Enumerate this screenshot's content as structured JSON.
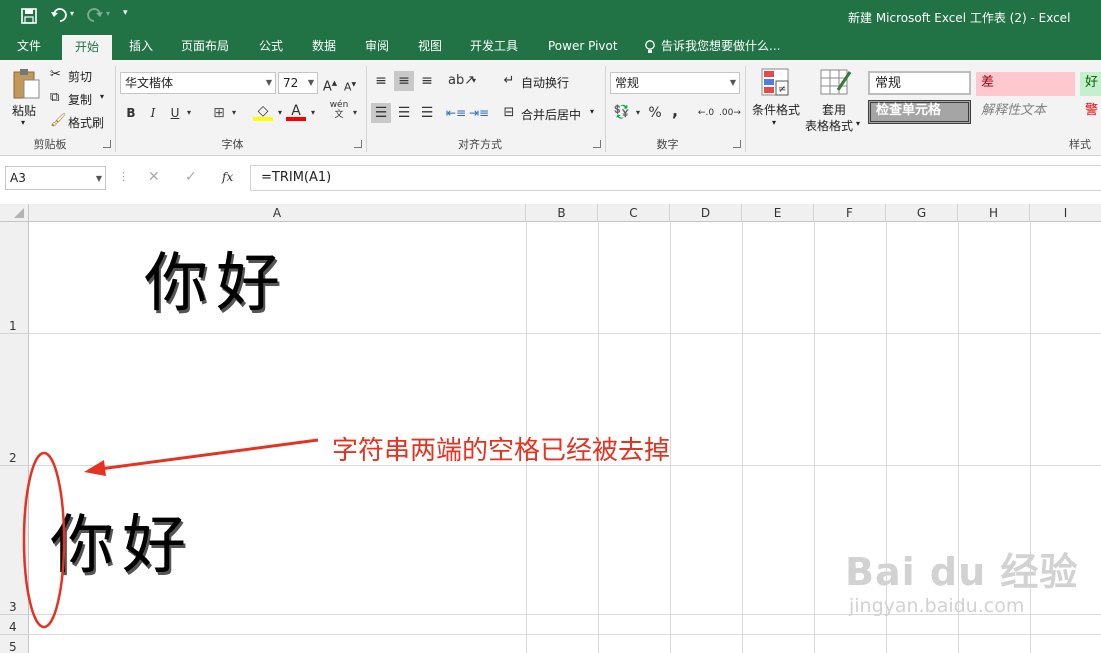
{
  "window": {
    "title": "新建 Microsoft Excel 工作表 (2) - Excel"
  },
  "tabs": [
    "文件",
    "开始",
    "插入",
    "页面布局",
    "公式",
    "数据",
    "审阅",
    "视图",
    "开发工具",
    "Power Pivot"
  ],
  "tell_me": "告诉我您想要做什么...",
  "ribbon": {
    "clipboard": {
      "paste": "粘贴",
      "cut": "剪切",
      "copy": "复制",
      "format_painter": "格式刷",
      "label": "剪贴板"
    },
    "font": {
      "name": "华文楷体",
      "size": "72",
      "bold": "B",
      "italic": "I",
      "underline": "U",
      "label": "字体",
      "wen": "wén"
    },
    "alignment": {
      "wrap": "自动换行",
      "merge": "合并后居中",
      "label": "对齐方式"
    },
    "number": {
      "format": "常规",
      "percent": "%",
      "comma": ",",
      "label": "数字"
    },
    "styles": {
      "cond": "条件格式",
      "table_a": "套用",
      "table_b": "表格格式",
      "normal": "常规",
      "bad": "差",
      "good": "好",
      "check": "检查单元格",
      "explain": "解释性文本",
      "warn": "警",
      "label": "样式"
    }
  },
  "formula_bar": {
    "name_box": "A3",
    "fx": "fx",
    "formula": "=TRIM(A1)"
  },
  "grid": {
    "columns": [
      "A",
      "B",
      "C",
      "D",
      "E",
      "F",
      "G",
      "H",
      "I"
    ],
    "rows": [
      "1",
      "2",
      "3",
      "4",
      "5"
    ],
    "cell_a1": "你好",
    "cell_a3": "你好"
  },
  "annotation": {
    "text": "字符串两端的空格已经被去掉",
    "color": "#e53322"
  },
  "watermark": {
    "brand": "Bai du 经验",
    "url": "jingyan.baidu.com"
  },
  "colors": {
    "excel_green": "#217346",
    "bad_bg": "#ffc7ce",
    "bad_fg": "#9c0006",
    "good_bg": "#c6efce",
    "good_fg": "#006100"
  }
}
